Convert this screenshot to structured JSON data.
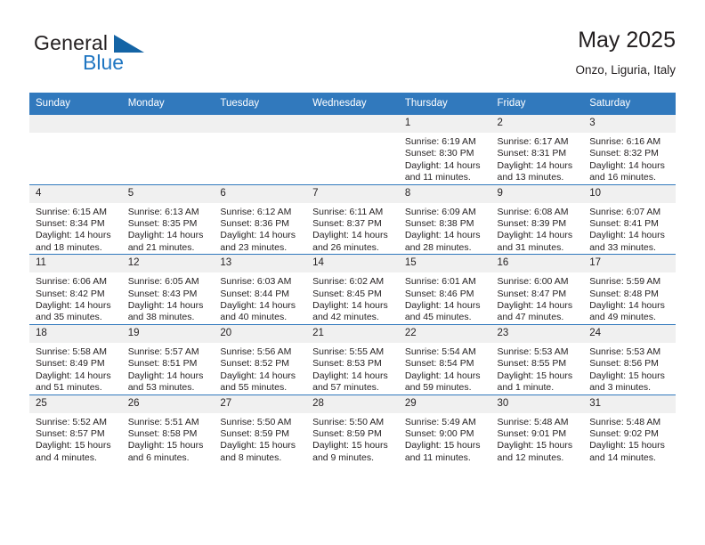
{
  "logo": {
    "text_primary": "General",
    "text_secondary": "Blue",
    "triangle_color": "#1464a5",
    "secondary_color": "#1f76c2"
  },
  "header": {
    "title": "May 2025",
    "subtitle": "Onzo, Liguria, Italy"
  },
  "theme": {
    "header_bg": "#3179bd",
    "header_text": "#ffffff",
    "daynum_bg": "#f0f0f0",
    "cell_bg": "#ffffff",
    "text": "#231f20"
  },
  "weekdays": [
    "Sunday",
    "Monday",
    "Tuesday",
    "Wednesday",
    "Thursday",
    "Friday",
    "Saturday"
  ],
  "weeks": [
    [
      {
        "day": "",
        "sunrise": "",
        "sunset": "",
        "daylight1": "",
        "daylight2": "",
        "empty": true
      },
      {
        "day": "",
        "sunrise": "",
        "sunset": "",
        "daylight1": "",
        "daylight2": "",
        "empty": true
      },
      {
        "day": "",
        "sunrise": "",
        "sunset": "",
        "daylight1": "",
        "daylight2": "",
        "empty": true
      },
      {
        "day": "",
        "sunrise": "",
        "sunset": "",
        "daylight1": "",
        "daylight2": "",
        "empty": true
      },
      {
        "day": "1",
        "sunrise": "Sunrise: 6:19 AM",
        "sunset": "Sunset: 8:30 PM",
        "daylight1": "Daylight: 14 hours",
        "daylight2": "and 11 minutes.",
        "empty": false
      },
      {
        "day": "2",
        "sunrise": "Sunrise: 6:17 AM",
        "sunset": "Sunset: 8:31 PM",
        "daylight1": "Daylight: 14 hours",
        "daylight2": "and 13 minutes.",
        "empty": false
      },
      {
        "day": "3",
        "sunrise": "Sunrise: 6:16 AM",
        "sunset": "Sunset: 8:32 PM",
        "daylight1": "Daylight: 14 hours",
        "daylight2": "and 16 minutes.",
        "empty": false
      }
    ],
    [
      {
        "day": "4",
        "sunrise": "Sunrise: 6:15 AM",
        "sunset": "Sunset: 8:34 PM",
        "daylight1": "Daylight: 14 hours",
        "daylight2": "and 18 minutes.",
        "empty": false
      },
      {
        "day": "5",
        "sunrise": "Sunrise: 6:13 AM",
        "sunset": "Sunset: 8:35 PM",
        "daylight1": "Daylight: 14 hours",
        "daylight2": "and 21 minutes.",
        "empty": false
      },
      {
        "day": "6",
        "sunrise": "Sunrise: 6:12 AM",
        "sunset": "Sunset: 8:36 PM",
        "daylight1": "Daylight: 14 hours",
        "daylight2": "and 23 minutes.",
        "empty": false
      },
      {
        "day": "7",
        "sunrise": "Sunrise: 6:11 AM",
        "sunset": "Sunset: 8:37 PM",
        "daylight1": "Daylight: 14 hours",
        "daylight2": "and 26 minutes.",
        "empty": false
      },
      {
        "day": "8",
        "sunrise": "Sunrise: 6:09 AM",
        "sunset": "Sunset: 8:38 PM",
        "daylight1": "Daylight: 14 hours",
        "daylight2": "and 28 minutes.",
        "empty": false
      },
      {
        "day": "9",
        "sunrise": "Sunrise: 6:08 AM",
        "sunset": "Sunset: 8:39 PM",
        "daylight1": "Daylight: 14 hours",
        "daylight2": "and 31 minutes.",
        "empty": false
      },
      {
        "day": "10",
        "sunrise": "Sunrise: 6:07 AM",
        "sunset": "Sunset: 8:41 PM",
        "daylight1": "Daylight: 14 hours",
        "daylight2": "and 33 minutes.",
        "empty": false
      }
    ],
    [
      {
        "day": "11",
        "sunrise": "Sunrise: 6:06 AM",
        "sunset": "Sunset: 8:42 PM",
        "daylight1": "Daylight: 14 hours",
        "daylight2": "and 35 minutes.",
        "empty": false
      },
      {
        "day": "12",
        "sunrise": "Sunrise: 6:05 AM",
        "sunset": "Sunset: 8:43 PM",
        "daylight1": "Daylight: 14 hours",
        "daylight2": "and 38 minutes.",
        "empty": false
      },
      {
        "day": "13",
        "sunrise": "Sunrise: 6:03 AM",
        "sunset": "Sunset: 8:44 PM",
        "daylight1": "Daylight: 14 hours",
        "daylight2": "and 40 minutes.",
        "empty": false
      },
      {
        "day": "14",
        "sunrise": "Sunrise: 6:02 AM",
        "sunset": "Sunset: 8:45 PM",
        "daylight1": "Daylight: 14 hours",
        "daylight2": "and 42 minutes.",
        "empty": false
      },
      {
        "day": "15",
        "sunrise": "Sunrise: 6:01 AM",
        "sunset": "Sunset: 8:46 PM",
        "daylight1": "Daylight: 14 hours",
        "daylight2": "and 45 minutes.",
        "empty": false
      },
      {
        "day": "16",
        "sunrise": "Sunrise: 6:00 AM",
        "sunset": "Sunset: 8:47 PM",
        "daylight1": "Daylight: 14 hours",
        "daylight2": "and 47 minutes.",
        "empty": false
      },
      {
        "day": "17",
        "sunrise": "Sunrise: 5:59 AM",
        "sunset": "Sunset: 8:48 PM",
        "daylight1": "Daylight: 14 hours",
        "daylight2": "and 49 minutes.",
        "empty": false
      }
    ],
    [
      {
        "day": "18",
        "sunrise": "Sunrise: 5:58 AM",
        "sunset": "Sunset: 8:49 PM",
        "daylight1": "Daylight: 14 hours",
        "daylight2": "and 51 minutes.",
        "empty": false
      },
      {
        "day": "19",
        "sunrise": "Sunrise: 5:57 AM",
        "sunset": "Sunset: 8:51 PM",
        "daylight1": "Daylight: 14 hours",
        "daylight2": "and 53 minutes.",
        "empty": false
      },
      {
        "day": "20",
        "sunrise": "Sunrise: 5:56 AM",
        "sunset": "Sunset: 8:52 PM",
        "daylight1": "Daylight: 14 hours",
        "daylight2": "and 55 minutes.",
        "empty": false
      },
      {
        "day": "21",
        "sunrise": "Sunrise: 5:55 AM",
        "sunset": "Sunset: 8:53 PM",
        "daylight1": "Daylight: 14 hours",
        "daylight2": "and 57 minutes.",
        "empty": false
      },
      {
        "day": "22",
        "sunrise": "Sunrise: 5:54 AM",
        "sunset": "Sunset: 8:54 PM",
        "daylight1": "Daylight: 14 hours",
        "daylight2": "and 59 minutes.",
        "empty": false
      },
      {
        "day": "23",
        "sunrise": "Sunrise: 5:53 AM",
        "sunset": "Sunset: 8:55 PM",
        "daylight1": "Daylight: 15 hours",
        "daylight2": "and 1 minute.",
        "empty": false
      },
      {
        "day": "24",
        "sunrise": "Sunrise: 5:53 AM",
        "sunset": "Sunset: 8:56 PM",
        "daylight1": "Daylight: 15 hours",
        "daylight2": "and 3 minutes.",
        "empty": false
      }
    ],
    [
      {
        "day": "25",
        "sunrise": "Sunrise: 5:52 AM",
        "sunset": "Sunset: 8:57 PM",
        "daylight1": "Daylight: 15 hours",
        "daylight2": "and 4 minutes.",
        "empty": false
      },
      {
        "day": "26",
        "sunrise": "Sunrise: 5:51 AM",
        "sunset": "Sunset: 8:58 PM",
        "daylight1": "Daylight: 15 hours",
        "daylight2": "and 6 minutes.",
        "empty": false
      },
      {
        "day": "27",
        "sunrise": "Sunrise: 5:50 AM",
        "sunset": "Sunset: 8:59 PM",
        "daylight1": "Daylight: 15 hours",
        "daylight2": "and 8 minutes.",
        "empty": false
      },
      {
        "day": "28",
        "sunrise": "Sunrise: 5:50 AM",
        "sunset": "Sunset: 8:59 PM",
        "daylight1": "Daylight: 15 hours",
        "daylight2": "and 9 minutes.",
        "empty": false
      },
      {
        "day": "29",
        "sunrise": "Sunrise: 5:49 AM",
        "sunset": "Sunset: 9:00 PM",
        "daylight1": "Daylight: 15 hours",
        "daylight2": "and 11 minutes.",
        "empty": false
      },
      {
        "day": "30",
        "sunrise": "Sunrise: 5:48 AM",
        "sunset": "Sunset: 9:01 PM",
        "daylight1": "Daylight: 15 hours",
        "daylight2": "and 12 minutes.",
        "empty": false
      },
      {
        "day": "31",
        "sunrise": "Sunrise: 5:48 AM",
        "sunset": "Sunset: 9:02 PM",
        "daylight1": "Daylight: 15 hours",
        "daylight2": "and 14 minutes.",
        "empty": false
      }
    ]
  ]
}
